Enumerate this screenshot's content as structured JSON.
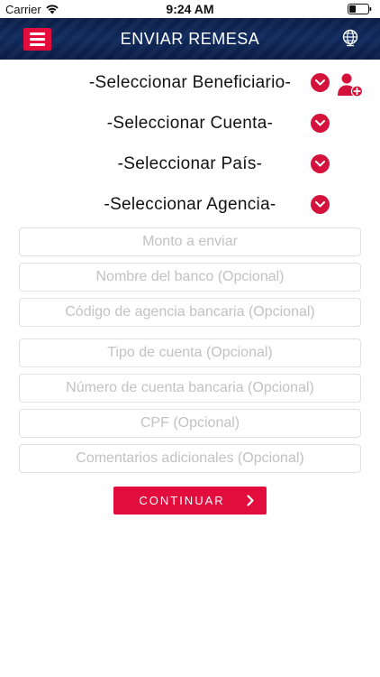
{
  "status_bar": {
    "carrier": "Carrier",
    "time": "9:24 AM"
  },
  "header": {
    "title": "ENVIAR REMESA",
    "menu_icon": "hamburger-menu-icon",
    "globe_icon": "globe-icon"
  },
  "selectors": {
    "beneficiary": "-Seleccionar Beneficiario-",
    "account": "-Seleccionar Cuenta-",
    "country": "-Seleccionar País-",
    "agency": "-Seleccionar Agencia-"
  },
  "fields": {
    "amount_placeholder": "Monto a enviar",
    "bank_name_placeholder": "Nombre del banco (Opcional)",
    "bank_agency_code_placeholder": "Código de agencia bancaria (Opcional)",
    "account_type_placeholder": "Tipo de cuenta (Opcional)",
    "account_number_placeholder": "Número de cuenta bancaria (Opcional)",
    "cpf_placeholder": "CPF (Opcional)",
    "comments_placeholder": "Comentarios adicionales (Opcional)"
  },
  "actions": {
    "continue_label": "CONTINUAR"
  },
  "colors": {
    "accent": "#e30d3d",
    "header_bg": "#0f2656",
    "placeholder": "#c2c2c2",
    "field_border": "#e1e1e1"
  }
}
